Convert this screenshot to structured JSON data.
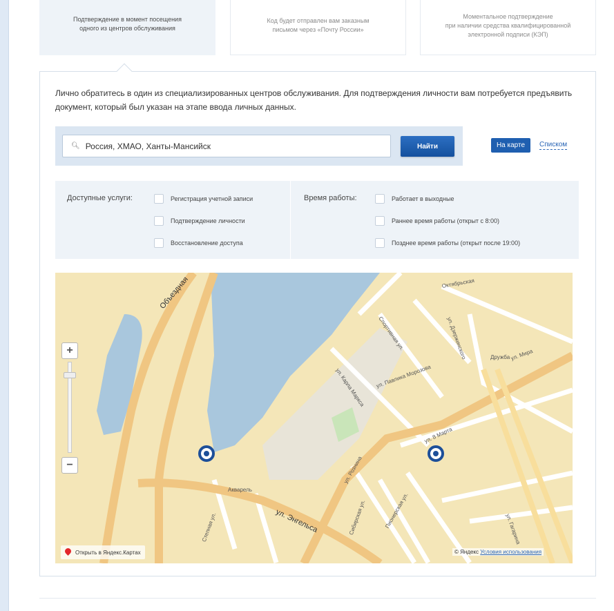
{
  "tabs": [
    {
      "lines": [
        "Подтверждение в момент посещения",
        "одного из центров обслуживания"
      ]
    },
    {
      "lines": [
        "Код будет отправлен вам заказным",
        "письмом через «Почту России»"
      ]
    },
    {
      "lines": [
        "Моментальное подтверждение",
        "при наличии средства квалифицированной",
        "электронной подписи (КЭП)"
      ]
    }
  ],
  "intro_text": "Лично обратитесь в один из специализированных центров обслуживания. Для подтверждения личности вам потребуется предъявить документ, который был указан на этапе ввода личных данных.",
  "search": {
    "value": "Россия, ХМАО, Ханты-Мансийск",
    "button_label": "Найти"
  },
  "view_toggle": {
    "map_label": "На карте",
    "list_label": "Списком"
  },
  "filters": {
    "services_label": "Доступные услуги:",
    "services": [
      "Регистрация учетной записи",
      "Подтверждение личности",
      "Восстановление доступа"
    ],
    "hours_label": "Время работы:",
    "hours": [
      "Работает в выходные",
      "Раннее время работы (открыт с 8:00)",
      "Позднее время работы (открыт после 19:00)"
    ]
  },
  "map": {
    "streets": {
      "obezdnaya": "Объездная",
      "engelsa": "ул. Энгельса",
      "rozhina": "ул. Рознина",
      "karla_marksa": "ул. Карла Маркса",
      "pavlika": "ул. Павлика Морозова",
      "dzerzhinskogo": "ул. Дзержинского",
      "mira": "ул. Мира",
      "sibirskaya": "Сибирская ул.",
      "pionerskaya": "Пионерская ул.",
      "stepnaya": "Степная ул.",
      "oktyabrskaya": "Октябрьская",
      "8marta": "ул. 8 Марта",
      "druzhba": "Дружба",
      "akvarel": "Акварель",
      "sportivnaya": "Спортивная ул.",
      "gagarina": "ул. Гагарина"
    },
    "open_label": "Открыть в Яндекс.Картах",
    "copyright": "© Яндекс",
    "terms": "Условия использования"
  }
}
